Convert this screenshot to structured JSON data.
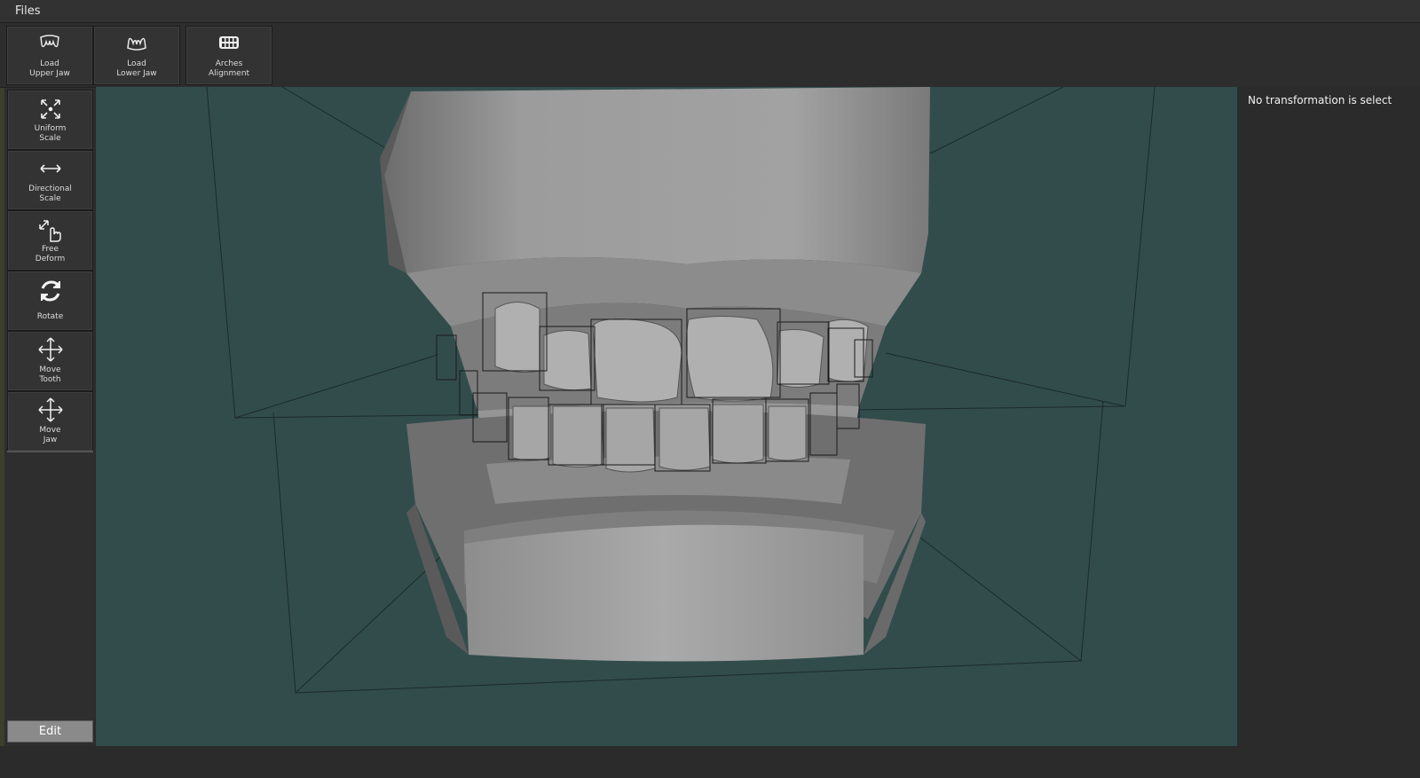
{
  "menubar": {
    "files_label": "Files"
  },
  "toolbar": {
    "buttons": [
      {
        "label": "Load\nUpper Jaw",
        "icon": "upper-jaw-icon"
      },
      {
        "label": "Load\nLower Jaw",
        "icon": "lower-jaw-icon"
      },
      {
        "label": "Arches\nAlignment",
        "icon": "arches-alignment-icon"
      }
    ]
  },
  "sidebar": {
    "items": [
      {
        "label": "Uniform\nScale",
        "icon": "uniform-scale-icon"
      },
      {
        "label": "Directional\nScale",
        "icon": "directional-scale-icon"
      },
      {
        "label": "Free\nDeform",
        "icon": "free-deform-icon"
      },
      {
        "label": "Rotate",
        "icon": "rotate-icon"
      },
      {
        "label": "Move\nTooth",
        "icon": "move-tooth-icon"
      },
      {
        "label": "Move\nJaw",
        "icon": "move-jaw-icon"
      }
    ],
    "edit_label": "Edit"
  },
  "right_panel": {
    "message": "No transformation is select"
  },
  "colors": {
    "viewport_bg": "#324c4c",
    "panel_bg": "#2b2b2b",
    "model_gray": "#9a9a9a"
  }
}
